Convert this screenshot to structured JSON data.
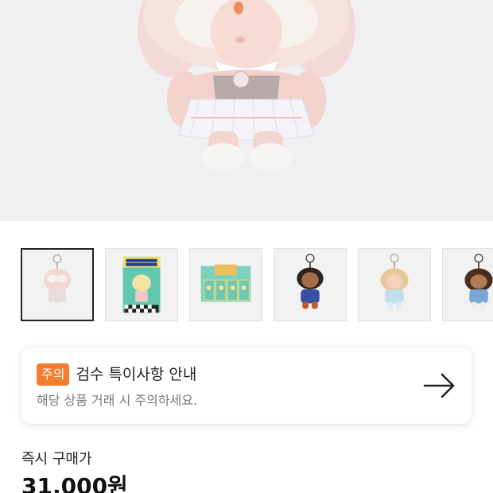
{
  "product_image": {
    "icon": "plush-doll-image"
  },
  "thumbnails": [
    {
      "name": "thumbnail-pink-doll",
      "selected": true
    },
    {
      "name": "thumbnail-box-front",
      "selected": false
    },
    {
      "name": "thumbnail-display-box",
      "selected": false
    },
    {
      "name": "thumbnail-dark-doll",
      "selected": false
    },
    {
      "name": "thumbnail-blonde-doll",
      "selected": false
    },
    {
      "name": "thumbnail-brown-doll",
      "selected": false
    }
  ],
  "notice": {
    "badge": "주의",
    "title": "검수 특이사항 안내",
    "subtitle": "해당 상품 거래 시 주의하세요.",
    "arrow_icon": "arrow-right-icon",
    "badge_color": "#f47c2d"
  },
  "price": {
    "label": "즉시 구매가",
    "value": "31,000원"
  }
}
